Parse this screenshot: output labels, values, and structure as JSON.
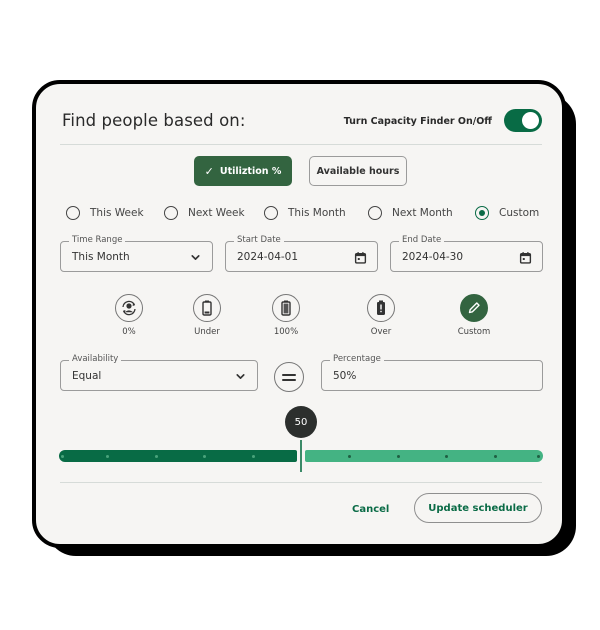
{
  "header": {
    "title": "Find people based on:",
    "toggle_label": "Turn Capacity Finder On/Off",
    "toggle_on": true
  },
  "mode_buttons": {
    "active_label": "Utiliztion %",
    "active_icon": "check-icon",
    "inactive_label": "Available hours"
  },
  "period_options": [
    {
      "label": "This Week",
      "checked": false
    },
    {
      "label": "Next Week",
      "checked": false
    },
    {
      "label": "This Month",
      "checked": false
    },
    {
      "label": "Next Month",
      "checked": false
    },
    {
      "label": "Custom",
      "checked": true
    }
  ],
  "fields": {
    "time_range": {
      "label": "Time Range",
      "value": "This Month",
      "icon": "chevron-down-icon"
    },
    "start_date": {
      "label": "Start Date",
      "value": "2024-04-01",
      "icon": "calendar-icon"
    },
    "end_date": {
      "label": "End Date",
      "value": "2024-04-30",
      "icon": "calendar-icon"
    },
    "availability": {
      "label": "Availability",
      "value": "Equal",
      "icon": "chevron-down-icon"
    },
    "percentage": {
      "label": "Percentage",
      "value": "50%"
    }
  },
  "capacity_options": [
    {
      "label": "0%",
      "icon": "person-cycle-icon",
      "active": false
    },
    {
      "label": "Under",
      "icon": "battery-low-icon",
      "active": false
    },
    {
      "label": "100%",
      "icon": "battery-full-icon",
      "active": false
    },
    {
      "label": "Over",
      "icon": "battery-alert-icon",
      "active": false
    },
    {
      "label": "Custom",
      "icon": "pencil-icon",
      "active": true
    }
  ],
  "operator_icon": "equals-icon",
  "slider": {
    "value": 50,
    "value_label": "50",
    "min": 0,
    "max": 100,
    "step_ticks": 10,
    "colors": {
      "filled": "#086b45",
      "remaining": "#44b383",
      "bubble": "#2c2f2d"
    }
  },
  "footer": {
    "cancel_label": "Cancel",
    "update_label": "Update scheduler"
  },
  "colors": {
    "accent": "#086b45",
    "button_green": "#336440",
    "card_bg": "#f6f5f3"
  }
}
